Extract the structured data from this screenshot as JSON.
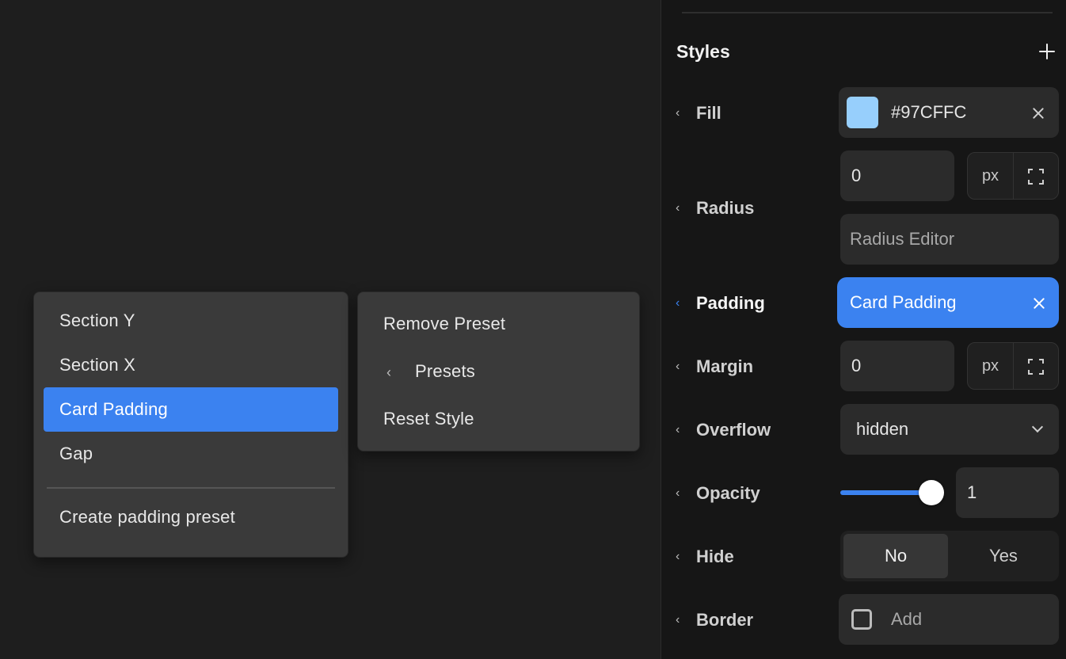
{
  "menu_presets": {
    "items": [
      {
        "label": "Section Y",
        "active": false
      },
      {
        "label": "Section X",
        "active": false
      },
      {
        "label": "Card Padding",
        "active": true
      },
      {
        "label": "Gap",
        "active": false
      }
    ],
    "create_label": "Create padding preset"
  },
  "menu_actions": {
    "remove_label": "Remove Preset",
    "presets_label": "Presets",
    "reset_label": "Reset Style"
  },
  "panel": {
    "title": "Styles",
    "fill": {
      "label": "Fill",
      "value": "#97CFFC",
      "swatch_color": "#97CFFC"
    },
    "radius": {
      "label": "Radius",
      "value": "0",
      "unit": "px",
      "editor_placeholder": "Radius Editor"
    },
    "padding": {
      "label": "Padding",
      "preset": "Card Padding"
    },
    "margin": {
      "label": "Margin",
      "value": "0",
      "unit": "px"
    },
    "overflow": {
      "label": "Overflow",
      "value": "hidden"
    },
    "opacity": {
      "label": "Opacity",
      "value": "1",
      "level": 1
    },
    "hide": {
      "label": "Hide",
      "options": [
        "No",
        "Yes"
      ],
      "selected": "No"
    },
    "border": {
      "label": "Border",
      "add_label": "Add"
    }
  },
  "colors": {
    "accent": "#3b82f0",
    "panel_bg": "#161616",
    "canvas_bg": "#1e1e1e",
    "menu_bg": "#3a3a3a"
  }
}
